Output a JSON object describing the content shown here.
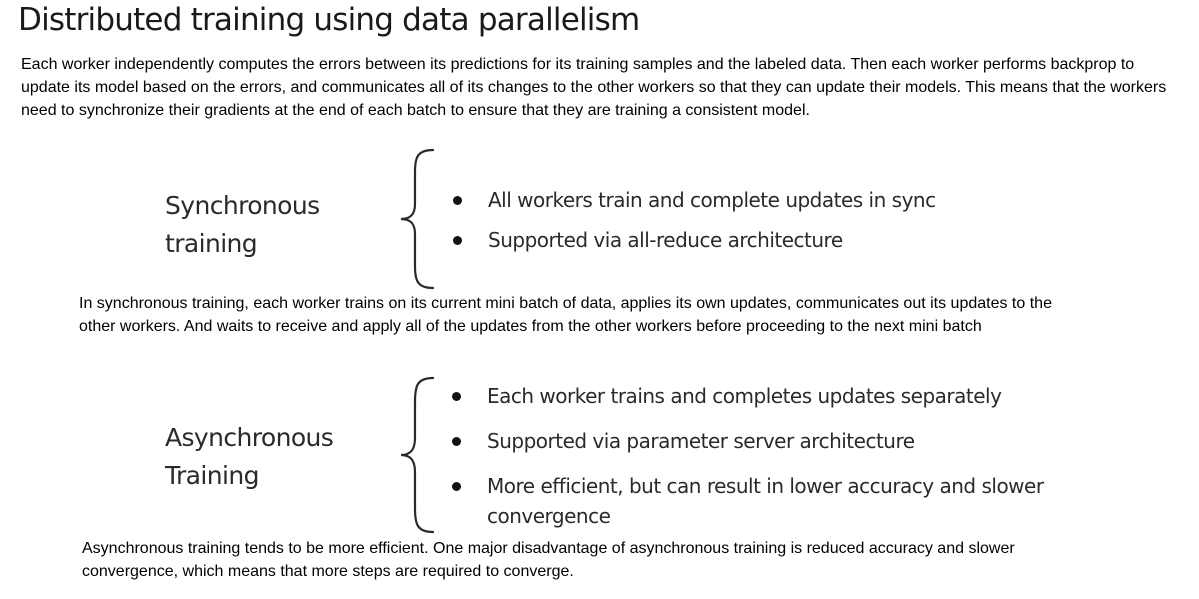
{
  "title": "Distributed training using data parallelism",
  "intro": "Each worker independently computes the errors between its predictions for its training samples and the labeled data. Then each worker performs backprop to update its model based on the errors, and communicates all of its changes to the other workers so that they can update their models. This means that the workers need to synchronize their gradients at the end of each batch to ensure that they are training a consistent model.",
  "synchronous": {
    "label_line1": "Synchronous",
    "label_line2": "training",
    "bullets": [
      "All workers train and complete updates in sync",
      "Supported via all-reduce architecture"
    ],
    "description": "In synchronous training, each worker trains on its current mini batch of data, applies its own updates, communicates out its updates to the other workers. And waits to receive and apply all of the updates from the other workers before proceeding to the next mini batch"
  },
  "asynchronous": {
    "label_line1": "Asynchronous",
    "label_line2": "Training",
    "bullets": [
      "Each worker trains and completes updates separately",
      "Supported via parameter server architecture",
      "More efficient, but can result in lower accuracy and slower convergence"
    ],
    "description": "Asynchronous training tends to be more efficient. One major disadvantage of asynchronous training is reduced accuracy and slower convergence, which means that more steps are required to converge."
  }
}
